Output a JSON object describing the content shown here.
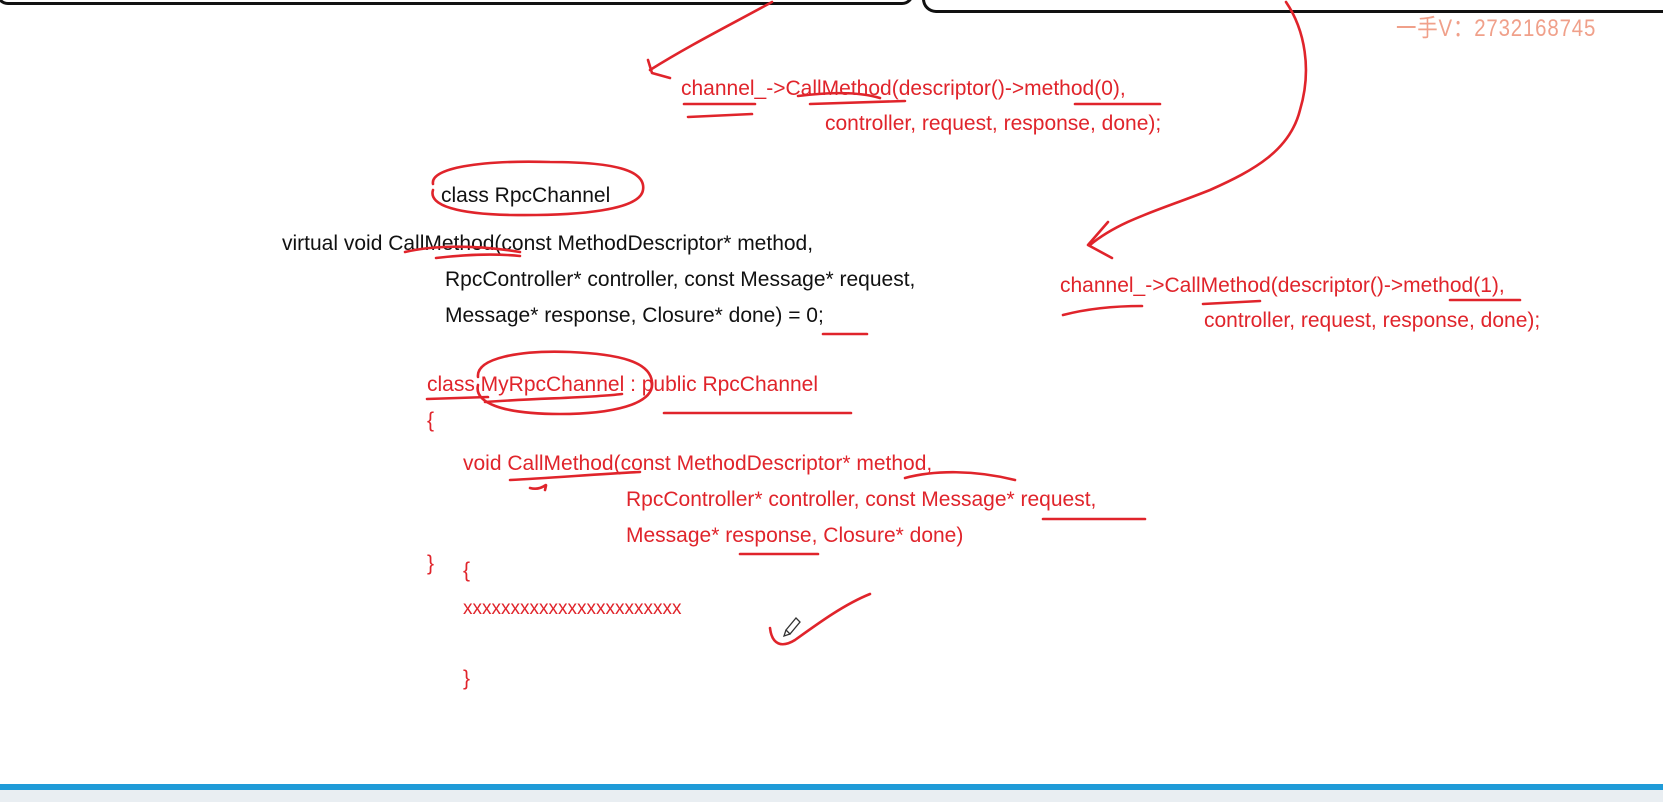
{
  "watermark": "一手V：2732168745",
  "red_call_top": {
    "line1": "channel_->CallMethod(descriptor()->method(0),",
    "line2": "controller, request, response, done);"
  },
  "rpc_channel": {
    "class_line": "class RpcChannel",
    "decl_line1": "virtual void CallMethod(const MethodDescriptor* method,",
    "decl_line2": "RpcController* controller, const Message* request,",
    "decl_line3": "Message* response, Closure* done) = 0;"
  },
  "red_call_right": {
    "line1": "channel_->CallMethod(descriptor()->method(1),",
    "line2": "controller, request, response, done);"
  },
  "my_rpc_channel": {
    "class_line": "class MyRpcChannel : public RpcChannel",
    "open_brace": "{",
    "method_line1": "void CallMethod(const MethodDescriptor* method,",
    "method_line2": "RpcController* controller, const Message* request,",
    "method_line3": "Message* response, Closure* done)",
    "close_brace": "}",
    "body_open": "{",
    "body_code": "xxxxxxxxxxxxxxxxxxxxxxx",
    "body_close": "}"
  },
  "colors": {
    "ink_red": "#e0242b",
    "text_black": "#111111",
    "bottom_bar": "#1f9bd8"
  }
}
